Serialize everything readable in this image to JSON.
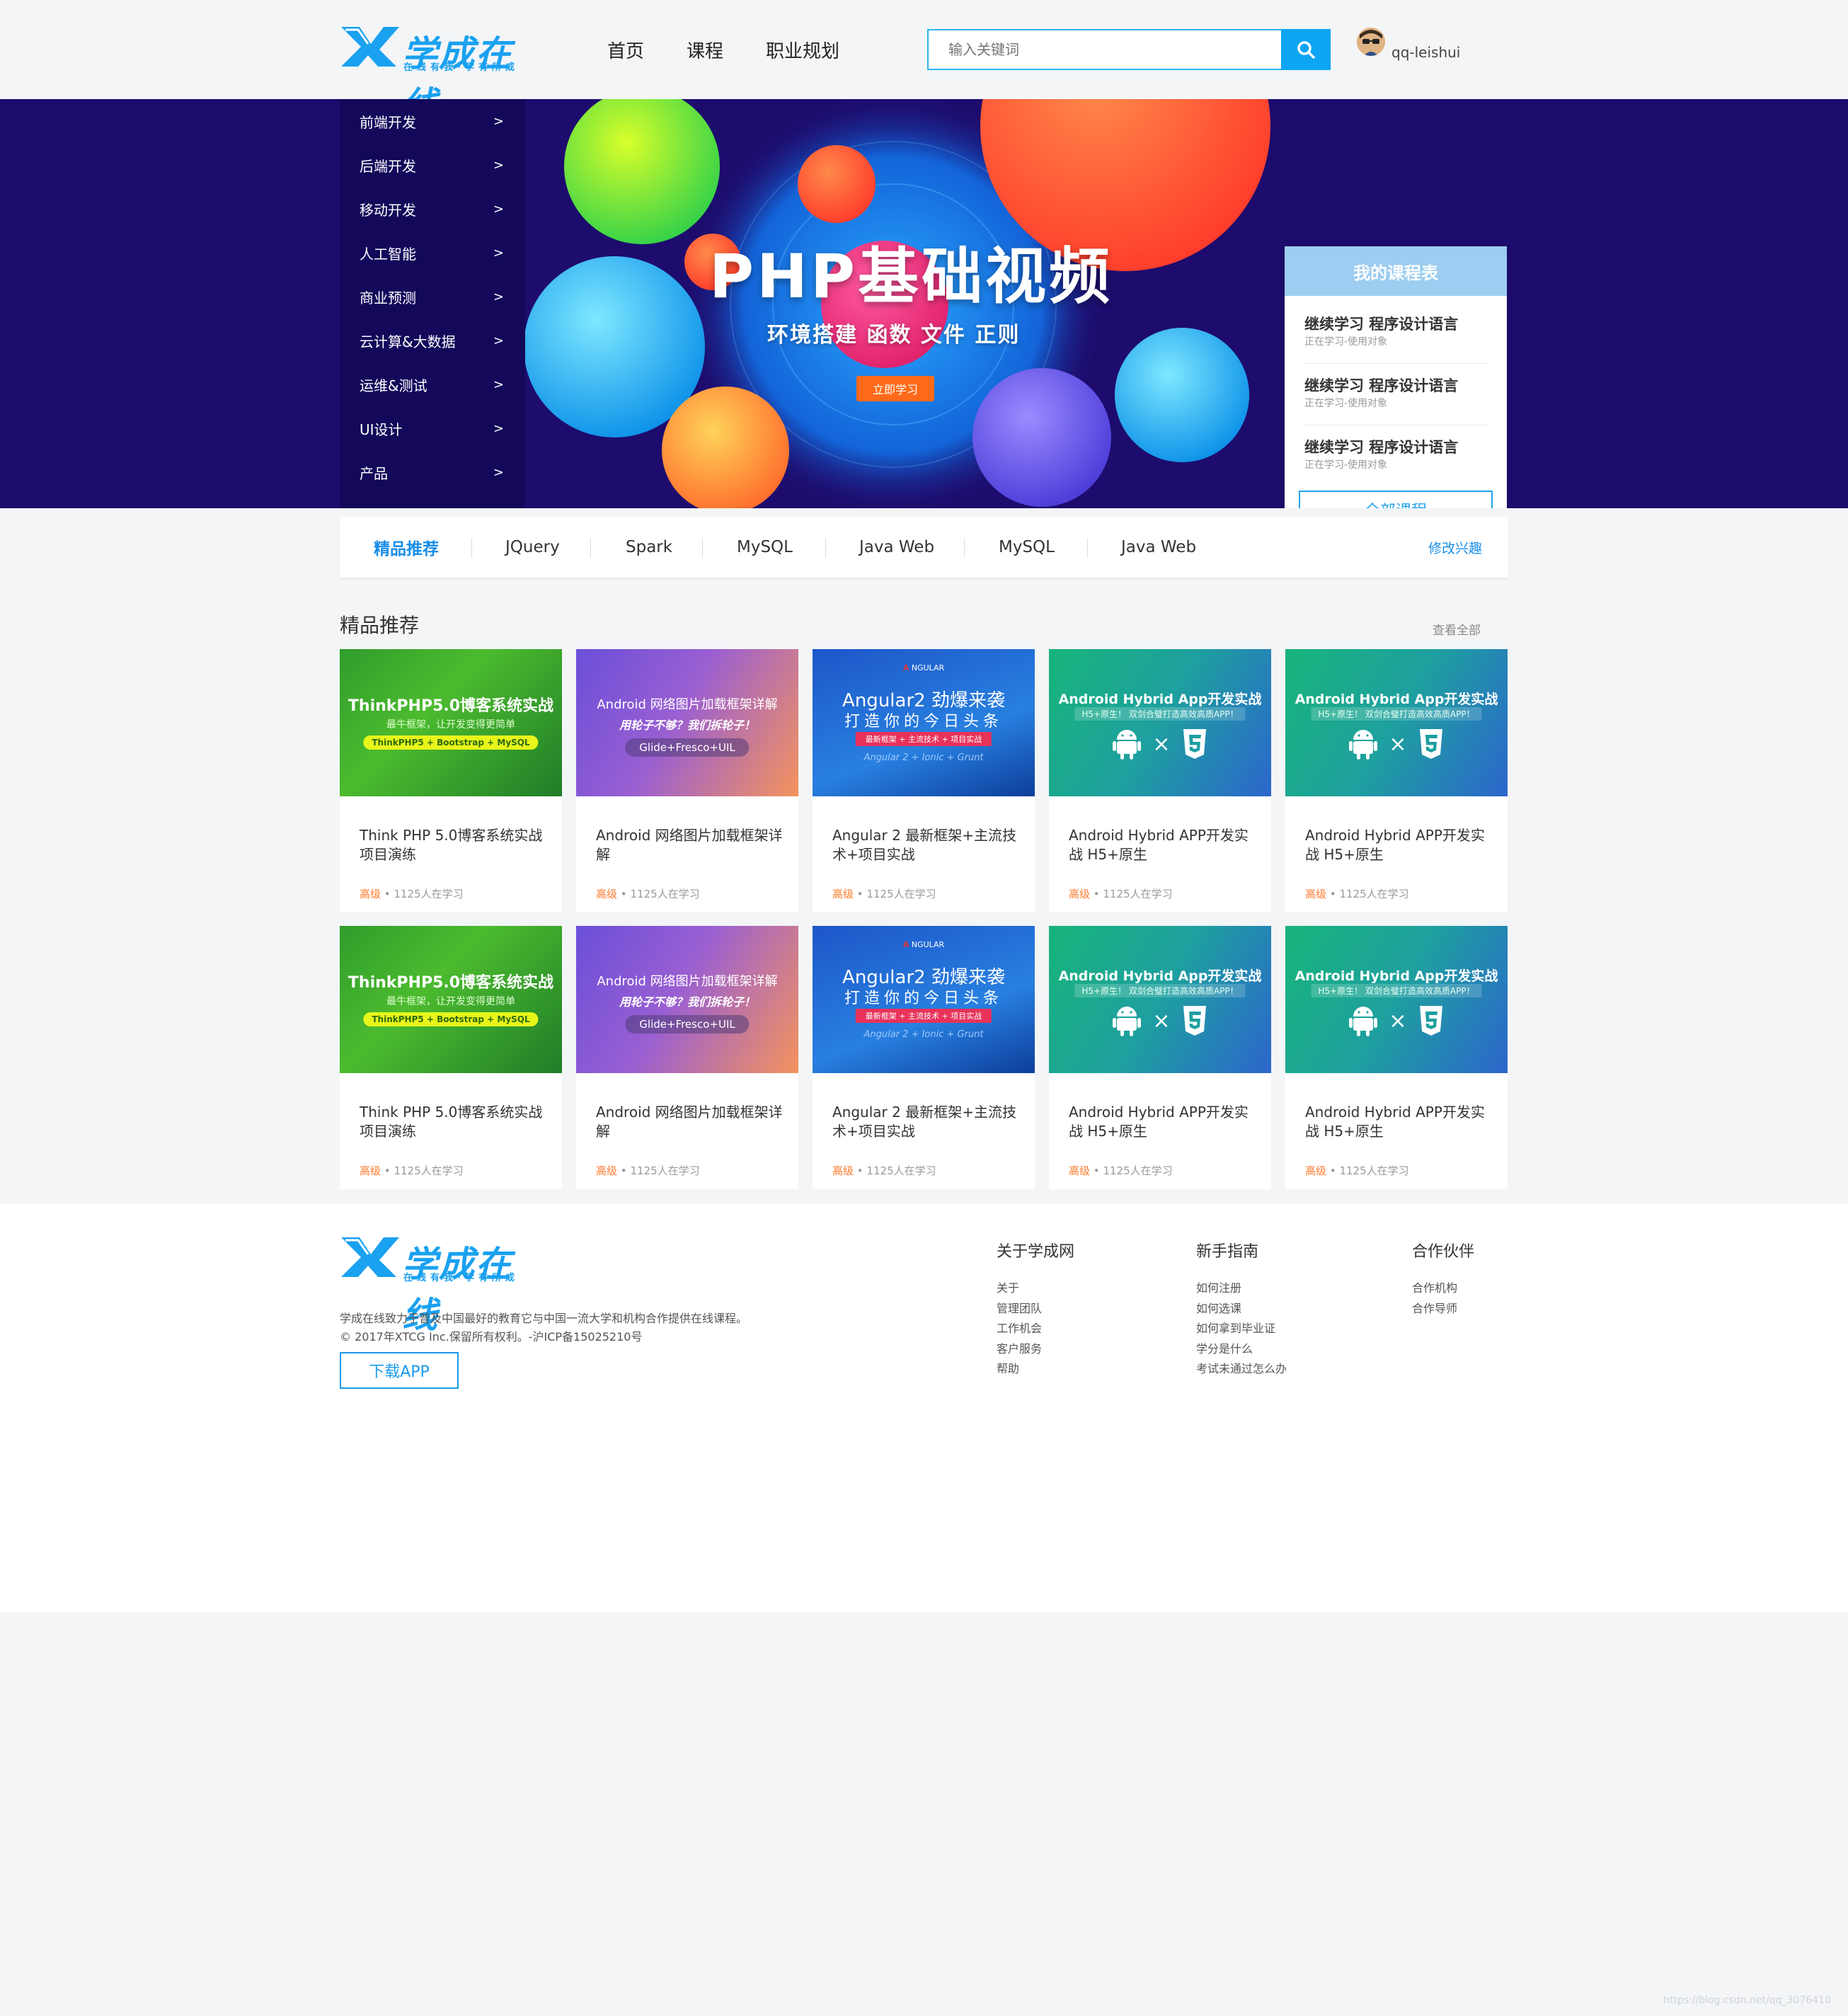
{
  "header": {
    "logo_text": "学成在线",
    "logo_slogan": "在线有我·学有所成",
    "nav": [
      "首页",
      "课程",
      "职业规划"
    ],
    "search_placeholder": "输入关键词",
    "username": "qq-leishui"
  },
  "categories": [
    {
      "label": "前端开发",
      "arrow": ">"
    },
    {
      "label": "后端开发",
      "arrow": ">"
    },
    {
      "label": "移动开发",
      "arrow": ">"
    },
    {
      "label": "人工智能",
      "arrow": ">"
    },
    {
      "label": "商业预测",
      "arrow": ">"
    },
    {
      "label": "云计算&大数据",
      "arrow": ">"
    },
    {
      "label": "运维&测试",
      "arrow": ">"
    },
    {
      "label": "UI设计",
      "arrow": ">"
    },
    {
      "label": "产品",
      "arrow": ">"
    }
  ],
  "banner": {
    "title": "PHP基础视频",
    "subtitle": "环境搭建  函数  文件  正则",
    "button": "立即学习"
  },
  "my_courses": {
    "header": "我的课程表",
    "items": [
      {
        "title": "继续学习 程序设计语言",
        "sub": "正在学习-使用对象"
      },
      {
        "title": "继续学习 程序设计语言",
        "sub": "正在学习-使用对象"
      },
      {
        "title": "继续学习 程序设计语言",
        "sub": "正在学习-使用对象"
      }
    ],
    "button": "全部课程"
  },
  "tabs": [
    "精品推荐",
    "JQuery",
    "Spark",
    "MySQL",
    "Java Web",
    "MySQL",
    "Java Web"
  ],
  "edit_interest": "修改兴趣",
  "section": {
    "title": "精品推荐",
    "view_all": "查看全部"
  },
  "card_art": {
    "php": {
      "line1": "ThinkPHP5.0博客系统实战",
      "line2": "最牛框架，让开发变得更简单",
      "pill": "ThinkPHP5 + Bootstrap + MySQL"
    },
    "android": {
      "line1": "Android 网络图片加载框架详解",
      "line2": "用轮子不够？我们拆轮子！",
      "pill": "Glide+Fresco+UIL"
    },
    "angular": {
      "brand": "NGULAR",
      "line1": "Angular2 劲爆来袭",
      "line2": "打造你的今日头条",
      "pill": "最新框架 + 主流技术 + 项目实战",
      "line3": "Angular 2 + Ionic + Grunt"
    },
    "hybrid": {
      "line1": "Android Hybrid App开发实战",
      "line2": "H5+原生！ 双剑合璧打造高效高质APP！",
      "times": "×"
    }
  },
  "cards": [
    {
      "art": "php",
      "title": "Think PHP 5.0博客系统实战项目演练",
      "level": "高级",
      "dot": "•",
      "students": "1125人在学习"
    },
    {
      "art": "android",
      "title": "Android 网络图片加载框架详解",
      "level": "高级",
      "dot": "•",
      "students": "1125人在学习"
    },
    {
      "art": "angular",
      "title": "Angular 2 最新框架+主流技术+项目实战",
      "level": "高级",
      "dot": "•",
      "students": "1125人在学习"
    },
    {
      "art": "hybrid",
      "title": "Android Hybrid APP开发实战 H5+原生",
      "level": "高级",
      "dot": "•",
      "students": "1125人在学习"
    },
    {
      "art": "hybrid",
      "title": "Android Hybrid APP开发实战 H5+原生",
      "level": "高级",
      "dot": "•",
      "students": "1125人在学习"
    },
    {
      "art": "php",
      "title": "Think PHP 5.0博客系统实战项目演练",
      "level": "高级",
      "dot": "•",
      "students": "1125人在学习"
    },
    {
      "art": "android",
      "title": "Android 网络图片加载框架详解",
      "level": "高级",
      "dot": "•",
      "students": "1125人在学习"
    },
    {
      "art": "angular",
      "title": "Angular 2 最新框架+主流技术+项目实战",
      "level": "高级",
      "dot": "•",
      "students": "1125人在学习"
    },
    {
      "art": "hybrid",
      "title": "Android Hybrid APP开发实战 H5+原生",
      "level": "高级",
      "dot": "•",
      "students": "1125人在学习"
    },
    {
      "art": "hybrid",
      "title": "Android Hybrid APP开发实战 H5+原生",
      "level": "高级",
      "dot": "•",
      "students": "1125人在学习"
    }
  ],
  "footer": {
    "description": "学成在线致力于普及中国最好的教育它与中国一流大学和机构合作提供在线课程。",
    "copyright": "© 2017年XTCG Inc.保留所有权利。-沪ICP备15025210号",
    "download": "下载APP",
    "columns": [
      {
        "title": "关于学成网",
        "links": [
          "关于",
          "管理团队",
          "工作机会",
          "客户服务",
          "帮助"
        ]
      },
      {
        "title": "新手指南",
        "links": [
          "如何注册",
          "如何选课",
          "如何拿到毕业证",
          "学分是什么",
          "考试未通过怎么办"
        ]
      },
      {
        "title": "合作伙伴",
        "links": [
          "合作机构",
          "合作导师"
        ]
      }
    ]
  },
  "watermark": "https://blog.csdn.net/qq_3076410"
}
